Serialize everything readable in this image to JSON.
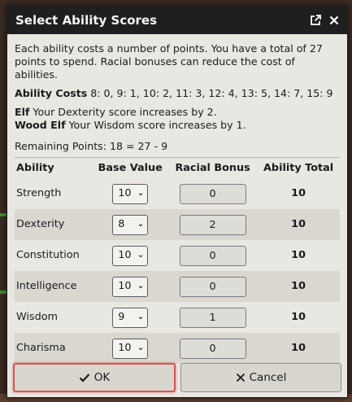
{
  "dialog": {
    "title": "Select Ability Scores",
    "popout_icon": "popout-icon",
    "close_icon": "close-icon"
  },
  "description": {
    "intro": "Each ability costs a number of points. You have a total of 27 points to spend. Racial bonuses can reduce the cost of abilities.",
    "costs_label": "Ability Costs",
    "costs_text": "8: 0, 9: 1, 10: 2, 11: 3, 12: 4, 13: 5, 14: 7, 15: 9",
    "bonuses": [
      {
        "race": "Elf",
        "text": "Your Dexterity score increases by 2."
      },
      {
        "race": "Wood Elf",
        "text": "Your Wisdom score increases by 1."
      }
    ],
    "remaining": "Remaining Points: 18 = 27 - 9"
  },
  "table": {
    "headers": [
      "Ability",
      "Base Value",
      "Racial Bonus",
      "Ability Total"
    ],
    "rows": [
      {
        "ability": "Strength",
        "base": "10",
        "racial": "0",
        "total": "10"
      },
      {
        "ability": "Dexterity",
        "base": "8",
        "racial": "2",
        "total": "10"
      },
      {
        "ability": "Constitution",
        "base": "10",
        "racial": "0",
        "total": "10"
      },
      {
        "ability": "Intelligence",
        "base": "10",
        "racial": "0",
        "total": "10"
      },
      {
        "ability": "Wisdom",
        "base": "9",
        "racial": "1",
        "total": "10"
      },
      {
        "ability": "Charisma",
        "base": "10",
        "racial": "0",
        "total": "10"
      }
    ]
  },
  "buttons": {
    "ok_label": "OK",
    "ok_icon": "checkmark-icon",
    "cancel_label": "Cancel",
    "cancel_icon": "x-icon"
  },
  "colors": {
    "titlebar": "#1f1f1f",
    "panel": "#e9e7e1",
    "ok_border": "#d9534f"
  }
}
